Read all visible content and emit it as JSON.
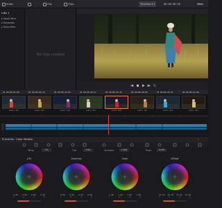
{
  "topbar": {
    "btn1": "Index",
    "btn2": "Clip",
    "btn3": "Clips",
    "timeline_name": "Timeline 4",
    "timecode": "00:00:38:20",
    "right_label": "Wedi"
  },
  "media_pool": {
    "folders": [
      "Bin 1",
      "Smart Bins",
      "Keywords",
      "Favourites"
    ],
    "empty_message": "No clips created"
  },
  "clips": [
    {
      "number": "01",
      "timecode": "00:00:01:09",
      "label": "Lumix Apt"
    },
    {
      "number": "02",
      "timecode": "00:00:06:14",
      "label": "Lumix Apt"
    },
    {
      "number": "03",
      "timecode": "00:00:12:02",
      "label": "Lumix Apt"
    },
    {
      "number": "04",
      "timecode": "00:00:18:11",
      "label": "Lumix Apt"
    },
    {
      "number": "05",
      "timecode": "00:00:24:16",
      "label": "Lumix Apt"
    },
    {
      "number": "06",
      "timecode": "00:00:30:05",
      "label": "Lumix Apt"
    },
    {
      "number": "07",
      "timecode": "00:00:35:21",
      "label": "Lumix Apt"
    },
    {
      "number": "08",
      "timecode": "00:00:41:08",
      "label": "Lumix Apt"
    }
  ],
  "color_panel": {
    "title": "Primaries - Color Wheels",
    "params": [
      {
        "label": "Temp",
        "value": "0.0"
      },
      {
        "label": "Tint",
        "value": "0.00"
      },
      {
        "label": "Contrast",
        "value": "1.000"
      },
      {
        "label": "Pivot",
        "value": "0.435"
      }
    ],
    "wheels": [
      {
        "title": "Lift",
        "values": [
          "0.00",
          "0.00",
          "0.00",
          "0.00"
        ]
      },
      {
        "title": "Gamma",
        "values": [
          "0.00",
          "0.00",
          "0.00",
          "0.00"
        ]
      },
      {
        "title": "Gain",
        "values": [
          "1.00",
          "1.00",
          "1.00",
          "1.00"
        ]
      },
      {
        "title": "Offset",
        "values": [
          "25.00",
          "25.00",
          "25.00",
          "25.00"
        ]
      }
    ],
    "channel_labels": [
      "Y",
      "R",
      "G",
      "B"
    ]
  },
  "icons": {
    "search": "search-icon",
    "play": "play-icon",
    "stop": "stop-icon",
    "prev": "prev-icon",
    "next": "next-icon"
  },
  "colors": {
    "accent": "#e8833a",
    "playhead": "#e0483c",
    "timeline_track": "#2e7fae"
  }
}
